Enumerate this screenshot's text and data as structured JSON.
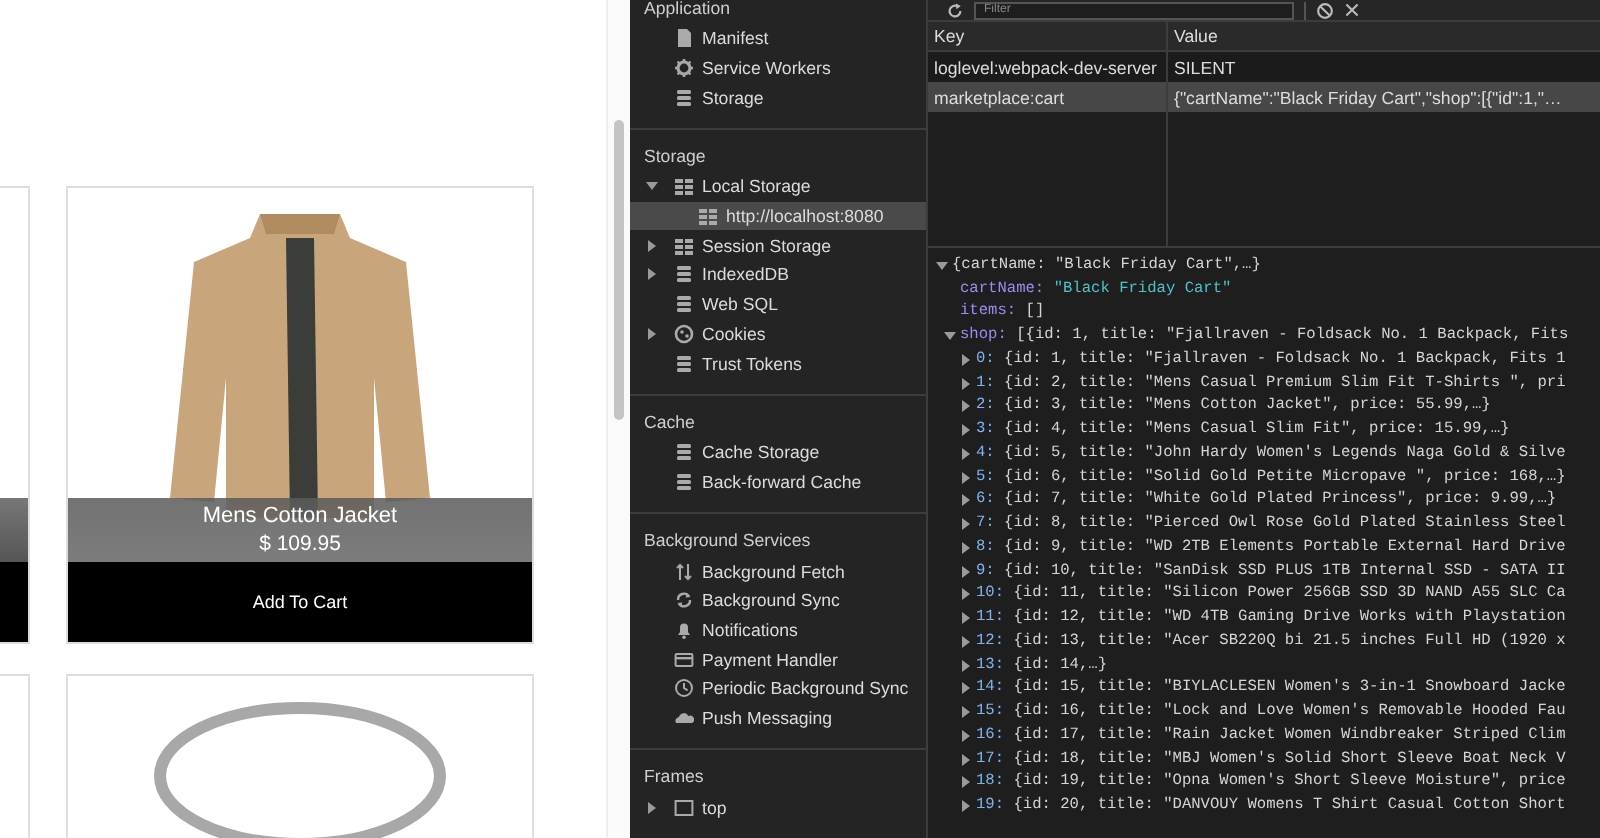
{
  "products": [
    {
      "kind": "jacket",
      "title": "Mens Cotton Jacket",
      "price": "$ 109.95",
      "button": "Add To Cart"
    },
    {
      "kind": "ring"
    }
  ],
  "sidebar": {
    "sections": [
      {
        "title": "Application",
        "items": [
          {
            "label": "Manifest",
            "kind": "file",
            "selected": false
          },
          {
            "label": "Service Workers",
            "kind": "gear",
            "selected": false
          },
          {
            "label": "Storage",
            "kind": "database",
            "selected": false
          }
        ]
      },
      {
        "title": "Storage",
        "items": [
          {
            "label": "Local Storage",
            "kind": "grid",
            "selected": false,
            "expanded": true,
            "children": [
              {
                "label": "http://localhost:8080",
                "kind": "grid",
                "selected": true
              }
            ]
          },
          {
            "label": "Session Storage",
            "kind": "grid",
            "selected": false,
            "expanded": false
          },
          {
            "label": "IndexedDB",
            "kind": "database",
            "selected": false,
            "expanded": false
          },
          {
            "label": "Web SQL",
            "kind": "database",
            "selected": false
          },
          {
            "label": "Cookies",
            "kind": "cookie",
            "selected": false,
            "expanded": false
          },
          {
            "label": "Trust Tokens",
            "kind": "database",
            "selected": false
          }
        ]
      },
      {
        "title": "Cache",
        "items": [
          {
            "label": "Cache Storage",
            "kind": "database",
            "selected": false
          },
          {
            "label": "Back-forward Cache",
            "kind": "database",
            "selected": false
          }
        ]
      },
      {
        "title": "Background Services",
        "items": [
          {
            "label": "Background Fetch",
            "kind": "arrows",
            "selected": false
          },
          {
            "label": "Background Sync",
            "kind": "sync",
            "selected": false
          },
          {
            "label": "Notifications",
            "kind": "bell",
            "selected": false
          },
          {
            "label": "Payment Handler",
            "kind": "card",
            "selected": false
          },
          {
            "label": "Periodic Background Sync",
            "kind": "clock",
            "selected": false
          },
          {
            "label": "Push Messaging",
            "kind": "cloud",
            "selected": false
          }
        ]
      },
      {
        "title": "Frames",
        "items": [
          {
            "label": "top",
            "kind": "frame",
            "selected": false,
            "expanded": false
          }
        ]
      }
    ]
  },
  "toolbar": {
    "placeholder": "Filter"
  },
  "table": {
    "columns": [
      "Key",
      "Value"
    ],
    "rows": [
      {
        "cells": [
          "loglevel:webpack-dev-server",
          "SILENT"
        ],
        "selected": false
      },
      {
        "cells": [
          "marketplace:cart",
          "{\"cartName\":\"Black Friday Cart\",\"shop\":[{\"id\":1,\"…"
        ],
        "selected": true
      }
    ]
  },
  "preview": {
    "summary": "{cartName: \"Black Friday Cart\",…}",
    "expanded": true,
    "children": [
      {
        "key": "cartName:",
        "value": "\"Black Friday Cart\"",
        "kind": "string"
      },
      {
        "key": "items:",
        "value": "[]",
        "kind": "plain"
      },
      {
        "key": "shop:",
        "value": "[{id: 1, title: \"Fjallraven - Foldsack No. 1 Backpack, Fits",
        "kind": "plain",
        "expanded": true,
        "children": [
          {
            "key": "0:",
            "value": "{id: 1, title: \"Fjallraven - Foldsack No. 1 Backpack, Fits 1",
            "expanded": false
          },
          {
            "key": "1:",
            "value": "{id: 2, title: \"Mens Casual Premium Slim Fit T-Shirts \", pri",
            "expanded": false
          },
          {
            "key": "2:",
            "value": "{id: 3, title: \"Mens Cotton Jacket\", price: 55.99,…}",
            "expanded": false
          },
          {
            "key": "3:",
            "value": "{id: 4, title: \"Mens Casual Slim Fit\", price: 15.99,…}",
            "expanded": false
          },
          {
            "key": "4:",
            "value": "{id: 5, title: \"John Hardy Women's Legends Naga Gold & Silve",
            "expanded": false
          },
          {
            "key": "5:",
            "value": "{id: 6, title: \"Solid Gold Petite Micropave \", price: 168,…}",
            "expanded": false
          },
          {
            "key": "6:",
            "value": "{id: 7, title: \"White Gold Plated Princess\", price: 9.99,…}",
            "expanded": false
          },
          {
            "key": "7:",
            "value": "{id: 8, title: \"Pierced Owl Rose Gold Plated Stainless Steel",
            "expanded": false
          },
          {
            "key": "8:",
            "value": "{id: 9, title: \"WD 2TB Elements Portable External Hard Drive",
            "expanded": false
          },
          {
            "key": "9:",
            "value": "{id: 10, title: \"SanDisk SSD PLUS 1TB Internal SSD - SATA II",
            "expanded": false
          },
          {
            "key": "10:",
            "value": "{id: 11, title: \"Silicon Power 256GB SSD 3D NAND A55 SLC Ca",
            "expanded": false
          },
          {
            "key": "11:",
            "value": "{id: 12, title: \"WD 4TB Gaming Drive Works with Playstation",
            "expanded": false
          },
          {
            "key": "12:",
            "value": "{id: 13, title: \"Acer SB220Q bi 21.5 inches Full HD (1920 x",
            "expanded": false
          },
          {
            "key": "13:",
            "value": "{id: 14,…}",
            "expanded": false
          },
          {
            "key": "14:",
            "value": "{id: 15, title: \"BIYLACLESEN Women's 3-in-1 Snowboard Jacke",
            "expanded": false
          },
          {
            "key": "15:",
            "value": "{id: 16, title: \"Lock and Love Women's Removable Hooded Fau",
            "expanded": false
          },
          {
            "key": "16:",
            "value": "{id: 17, title: \"Rain Jacket Women Windbreaker Striped Clim",
            "expanded": false
          },
          {
            "key": "17:",
            "value": "{id: 18, title: \"MBJ Women's Solid Short Sleeve Boat Neck V",
            "expanded": false
          },
          {
            "key": "18:",
            "value": "{id: 19, title: \"Opna Women's Short Sleeve Moisture\", price",
            "expanded": false
          },
          {
            "key": "19:",
            "value": "{id: 20, title: \"DANVOUY Womens T Shirt Casual Cotton Short",
            "expanded": false
          }
        ]
      }
    ]
  }
}
